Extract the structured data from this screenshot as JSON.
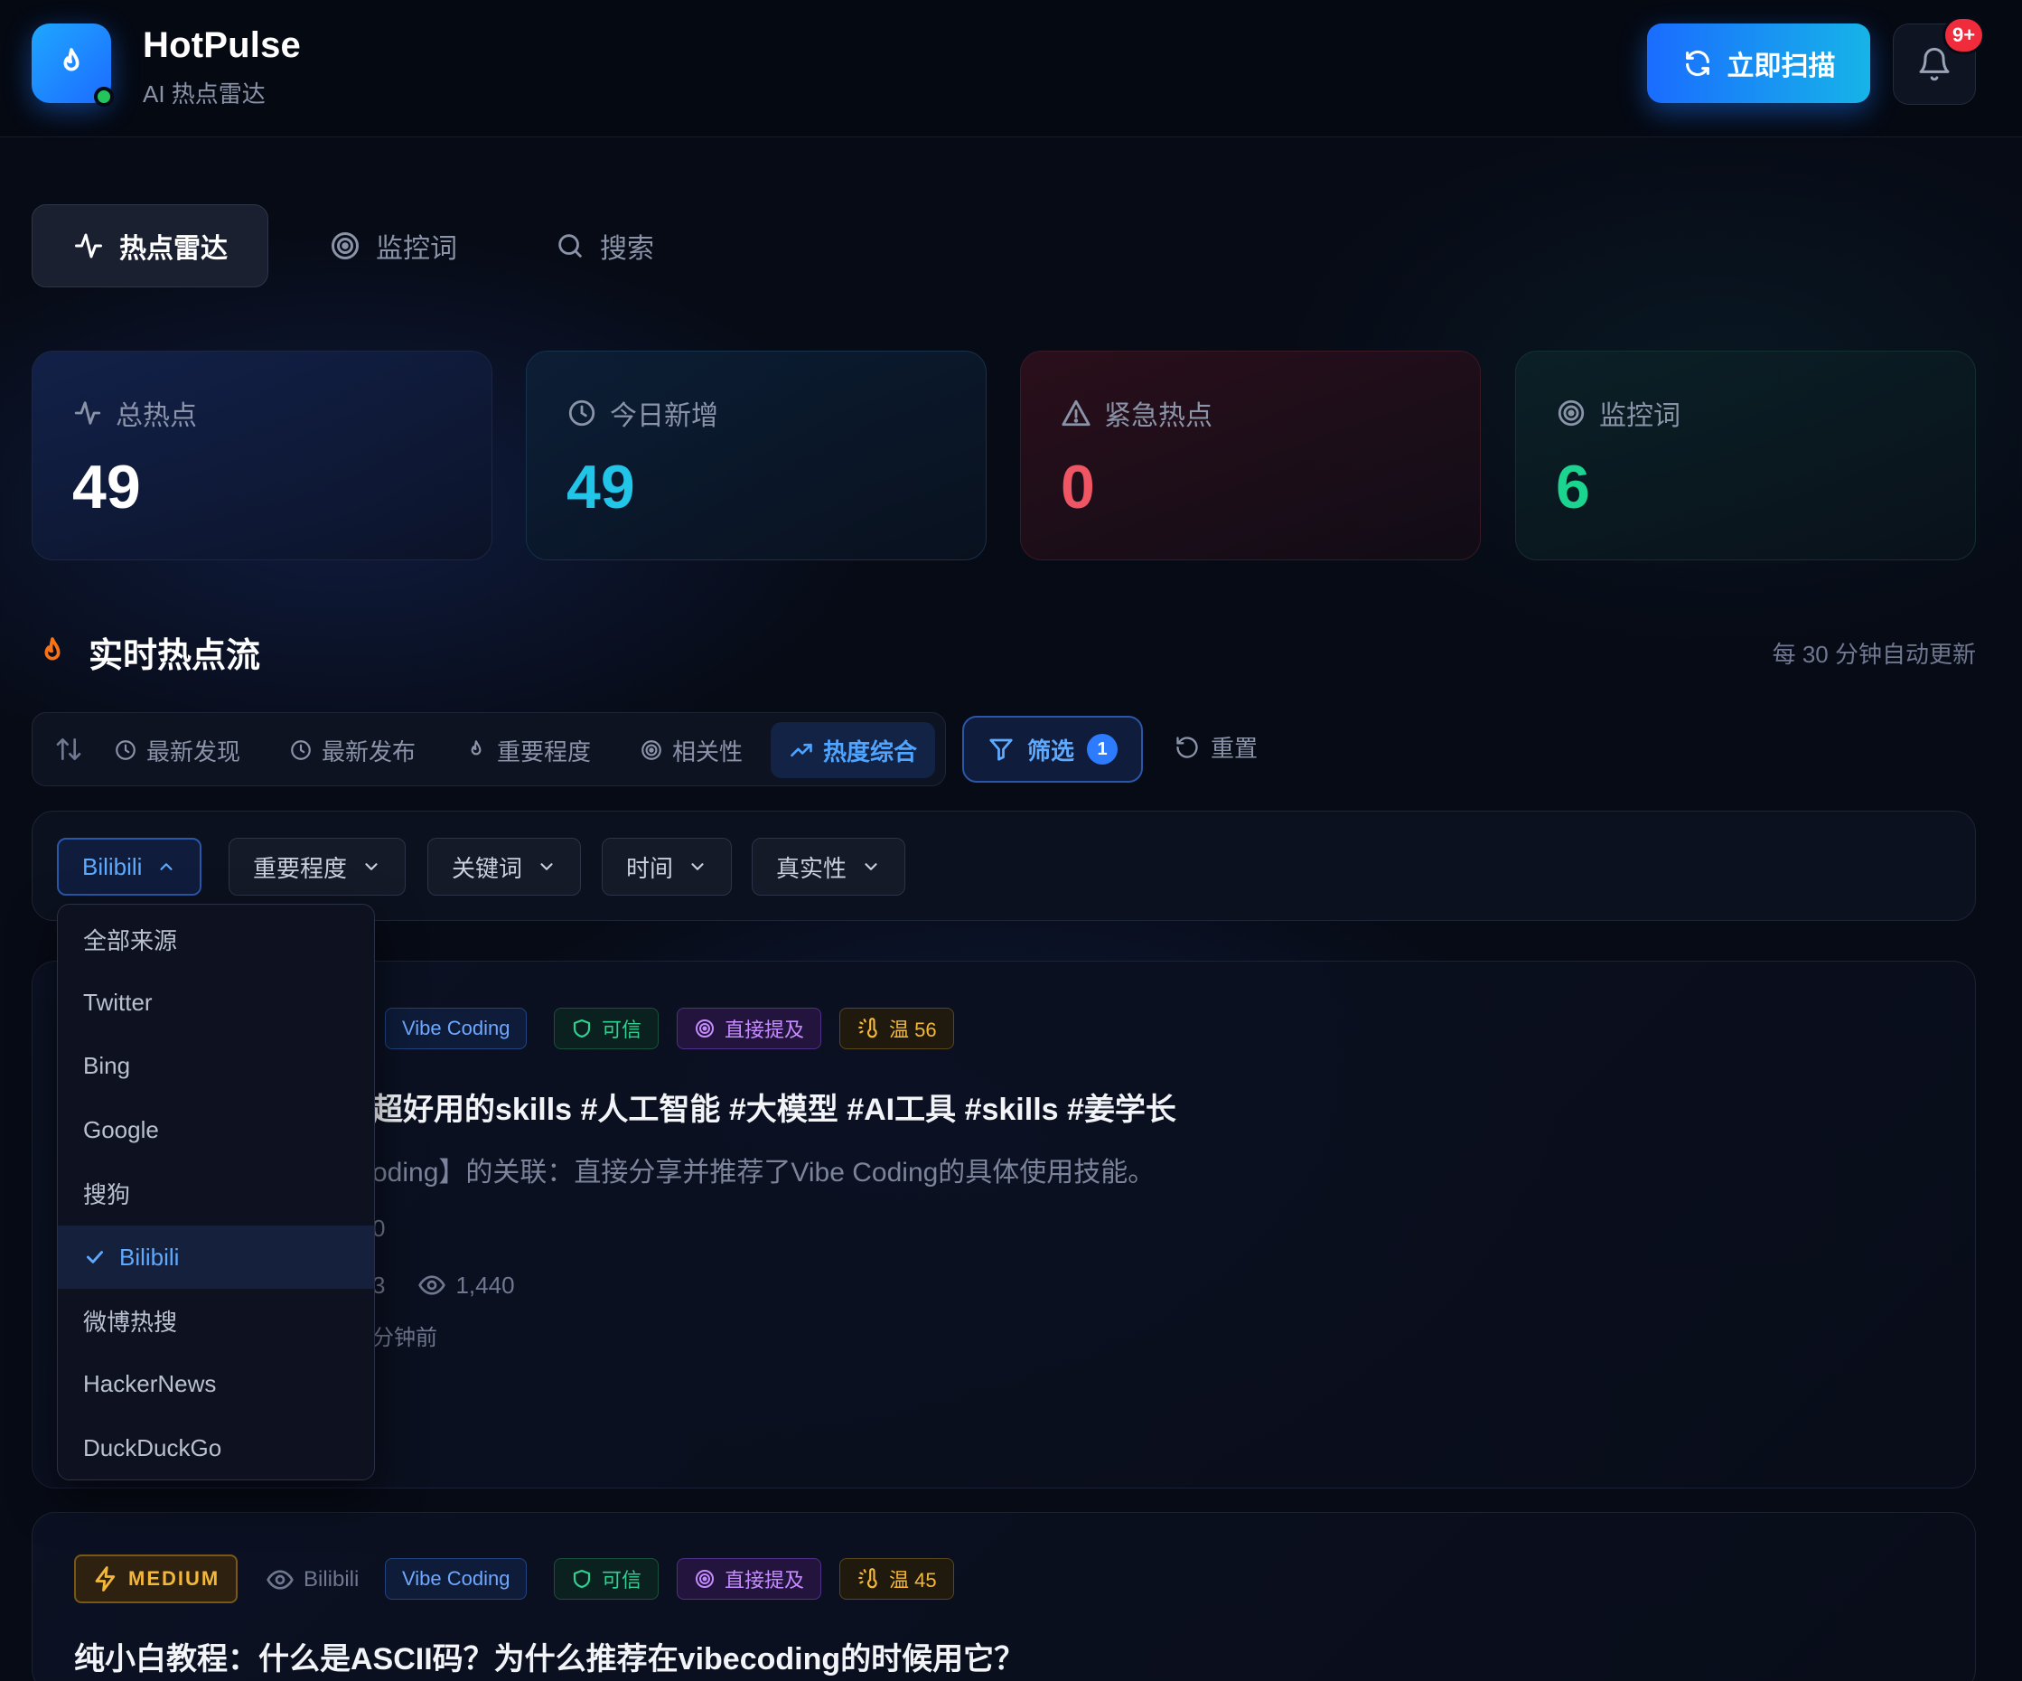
{
  "brand": {
    "name": "HotPulse",
    "subtitle": "AI 热点雷达"
  },
  "header": {
    "scan_label": "立即扫描",
    "notifications_badge": "9+"
  },
  "nav": {
    "tabs": [
      {
        "label": "热点雷达",
        "icon": "activity-icon",
        "active": true
      },
      {
        "label": "监控词",
        "icon": "target-icon",
        "active": false
      },
      {
        "label": "搜索",
        "icon": "search-icon",
        "active": false
      }
    ]
  },
  "stats": [
    {
      "label": "总热点",
      "value": "49",
      "icon": "activity-icon"
    },
    {
      "label": "今日新增",
      "value": "49",
      "icon": "clock-icon"
    },
    {
      "label": "紧急热点",
      "value": "0",
      "icon": "alert-triangle-icon"
    },
    {
      "label": "监控词",
      "value": "6",
      "icon": "target-icon"
    }
  ],
  "colors": {
    "accent": "#1a6cff",
    "cyan": "#20c5e8",
    "red": "#f05563",
    "green": "#1bd48f",
    "amber": "#f3b73a"
  },
  "feed": {
    "title": "实时热点流",
    "auto_update": "每 30 分钟自动更新",
    "sort": {
      "options": [
        {
          "label": "最新发现",
          "icon": "clock-icon",
          "active": false
        },
        {
          "label": "最新发布",
          "icon": "clock-icon",
          "active": false
        },
        {
          "label": "重要程度",
          "icon": "flame-icon",
          "active": false
        },
        {
          "label": "相关性",
          "icon": "target-icon",
          "active": false
        },
        {
          "label": "热度综合",
          "icon": "trending-up-icon",
          "active": true
        }
      ]
    },
    "filter_label": "筛选",
    "filter_count": "1",
    "reset_label": "重置"
  },
  "filters": {
    "dropdowns": [
      {
        "label": "Bilibili",
        "open": true
      },
      {
        "label": "重要程度",
        "open": false
      },
      {
        "label": "关键词",
        "open": false
      },
      {
        "label": "时间",
        "open": false
      },
      {
        "label": "真实性",
        "open": false
      }
    ],
    "source_options": [
      "全部来源",
      "Twitter",
      "Bing",
      "Google",
      "搜狗",
      "Bilibili",
      "微博热搜",
      "HackerNews",
      "DuckDuckGo"
    ],
    "selected_source": "Bilibili"
  },
  "cards": [
    {
      "tags": {
        "topic": "Vibe Coding",
        "trust": "可信",
        "mention": "直接提及",
        "temp": "温 56"
      },
      "title_visible": "超好用的skills #人工智能 #大模型 #AI工具 #skills #姜学长",
      "desc_visible": "oding】的关联：直接分享并推荐了Vibe Coding的具体使用技能。",
      "meta_score_visible": "0",
      "comments_visible": "3",
      "views": "1,440",
      "time_visible": "分钟前"
    },
    {
      "level": "MEDIUM",
      "source": "Bilibili",
      "tags": {
        "topic": "Vibe Coding",
        "trust": "可信",
        "mention": "直接提及",
        "temp": "温 45"
      },
      "title": "纯小白教程：什么是ASCII码？为什么推荐在vibecoding的时候用它？"
    }
  ]
}
